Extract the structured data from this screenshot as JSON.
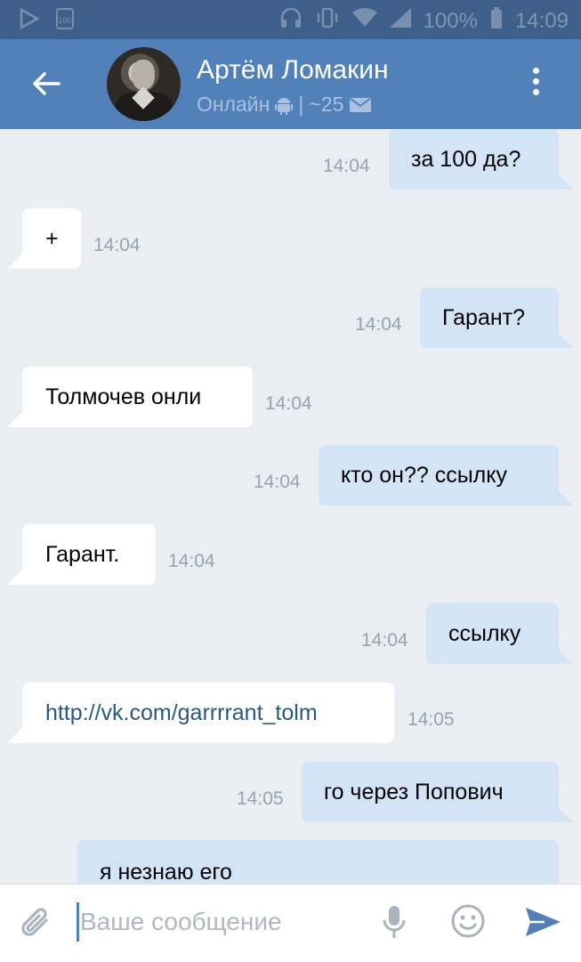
{
  "status_bar": {
    "battery": "100%",
    "time": "14:09",
    "icons": [
      "play-icon",
      "notification-icon",
      "headset-icon",
      "vibrate-icon",
      "wifi-icon",
      "signal-icon",
      "battery-icon"
    ]
  },
  "header": {
    "contact_name": "Артём Ломакин",
    "status_online": "Онлайн",
    "status_separator": "|",
    "status_count": "~25"
  },
  "messages": [
    {
      "direction": "out",
      "text": "за 100 да?",
      "time": "14:04"
    },
    {
      "direction": "in",
      "text": "+",
      "time": "14:04"
    },
    {
      "direction": "out",
      "text": "Гарант?",
      "time": "14:04"
    },
    {
      "direction": "in",
      "text": "Толмочев онли",
      "time": "14:04"
    },
    {
      "direction": "out",
      "text": "кто он?? ссылку",
      "time": "14:04"
    },
    {
      "direction": "in",
      "text": "Гарант.",
      "time": "14:04"
    },
    {
      "direction": "out",
      "text": "ссылку",
      "time": "14:04"
    },
    {
      "direction": "in",
      "text": "http://vk.com/garrrrant_tolm",
      "time": "14:05",
      "is_link": true
    },
    {
      "direction": "out",
      "text": "го через Попович",
      "time": "14:05"
    },
    {
      "direction": "out",
      "text": "я незнаю его",
      "time": ""
    }
  ],
  "input": {
    "placeholder": "Ваше сообщение",
    "value": ""
  },
  "colors": {
    "header_bg": "#5181b8",
    "status_bar_bg": "#3e5f8a",
    "chat_bg": "#eaeef3",
    "outgoing_bubble": "#d4e4f7",
    "incoming_bubble": "#ffffff",
    "link": "#2a5885",
    "accent": "#5181b8"
  }
}
